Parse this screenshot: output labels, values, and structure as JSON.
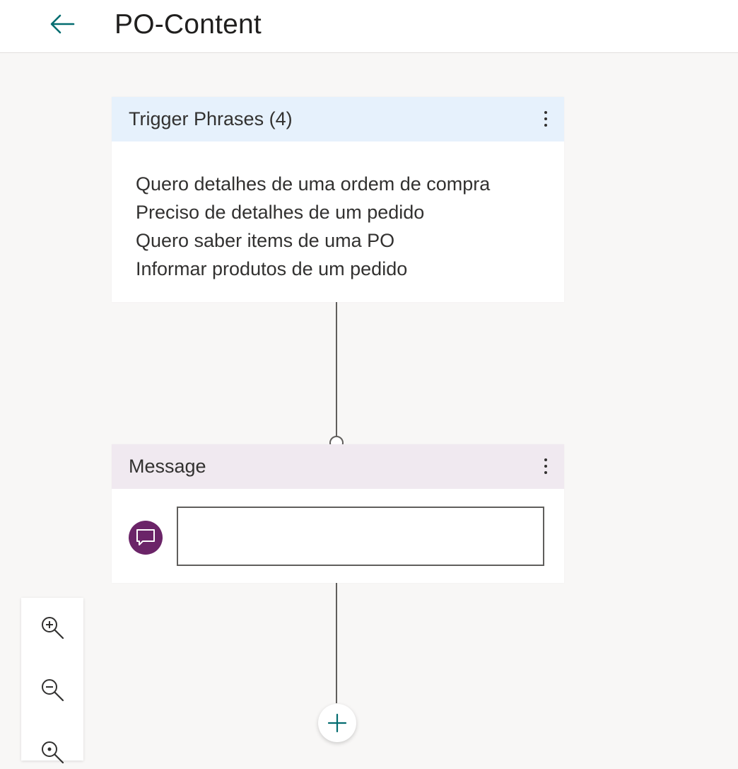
{
  "header": {
    "title": "PO-Content",
    "back_icon": "arrow-left-icon",
    "accent_color": "#036c70"
  },
  "trigger_node": {
    "title": "Trigger Phrases (4)",
    "menu_icon": "more-vertical-icon",
    "header_color": "#e6f1fc",
    "phrases": [
      "Quero detalhes de uma ordem de compra",
      "Preciso de detalhes de um pedido",
      "Quero saber items de uma PO",
      "Informar produtos de um pedido"
    ]
  },
  "message_node": {
    "title": "Message",
    "menu_icon": "more-vertical-icon",
    "header_color": "#f0e9f0",
    "avatar_icon": "chat-bubble-icon",
    "avatar_color": "#6b2468",
    "input_value": ""
  },
  "canvas": {
    "add_icon": "plus-icon",
    "zoom_controls": [
      "zoom-in-icon",
      "zoom-out-icon",
      "fit-to-screen-icon"
    ]
  }
}
